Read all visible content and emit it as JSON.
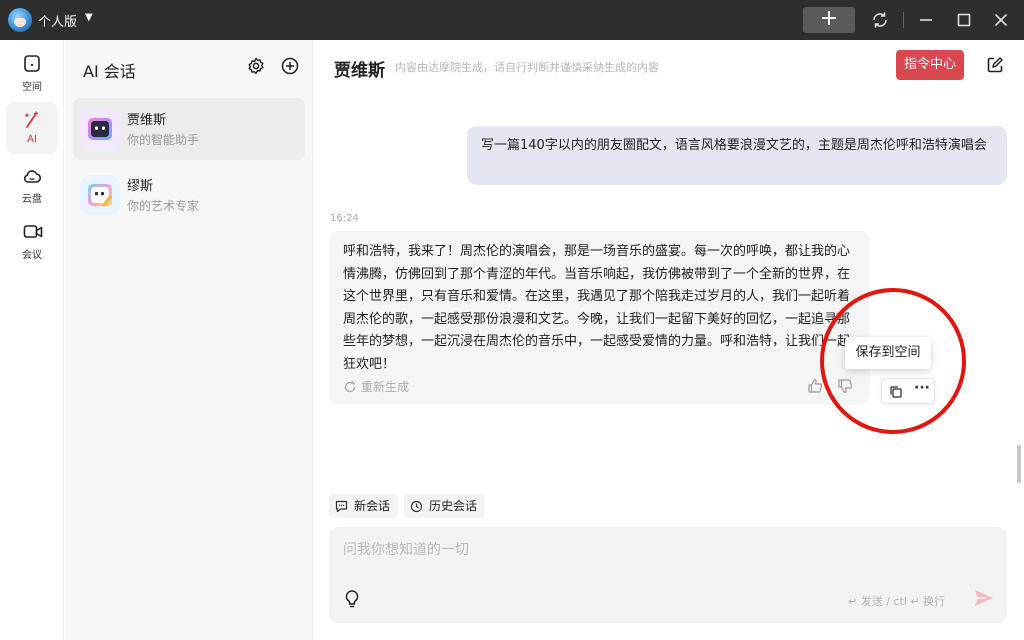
{
  "titlebar": {
    "title": "个人版",
    "plus_label": "+"
  },
  "rail": {
    "items": [
      {
        "label": "空间",
        "icon": "square-icon"
      },
      {
        "label": "AI",
        "icon": "magic-wand-icon"
      },
      {
        "label": "云盘",
        "icon": "cloud-icon"
      },
      {
        "label": "会议",
        "icon": "video-icon"
      }
    ],
    "active": "AI"
  },
  "sessions": {
    "title": "AI 会话",
    "items": [
      {
        "name": "贾维斯",
        "desc": "你的智能助手"
      },
      {
        "name": "缪斯",
        "desc": "你的艺术专家"
      }
    ]
  },
  "header": {
    "name": "贾维斯",
    "note": "内容由达摩院生成，请自行判断并谨慎采纳生成的内容",
    "command_center": "指令中心"
  },
  "chat": {
    "user_message": "写一篇140字以内的朋友圈配文，语言风格要浪漫文艺的，主题是周杰伦呼和浩特演唱会",
    "time": "16:24",
    "ai_message": "呼和浩特，我来了！周杰伦的演唱会，那是一场音乐的盛宴。每一次的呼唤，都让我的心情沸腾，仿佛回到了那个青涩的年代。当音乐响起，我仿佛被带到了一个全新的世界，在这个世界里，只有音乐和爱情。在这里，我遇见了那个陪我走过岁月的人，我们一起听着周杰伦的歌，一起感受那份浪漫和文艺。今晚，让我们一起留下美好的回忆，一起追寻那些年的梦想，一起沉浸在周杰伦的音乐中，一起感受爱情的力量。呼和浩特，让我们一起狂欢吧！",
    "regenerate": "重新生成",
    "tooltip": "保存到空间",
    "more": "···"
  },
  "chips": {
    "new_chat": "新会话",
    "history": "历史会话"
  },
  "input": {
    "placeholder": "问我你想知道的一切",
    "hint": "↵ 发送 / ctl ↵ 换行"
  },
  "colors": {
    "accent": "#d9474f",
    "titlebar": "#2e2e2e",
    "user_bubble": "#e4e6f1",
    "annotation": "#e5140f"
  }
}
